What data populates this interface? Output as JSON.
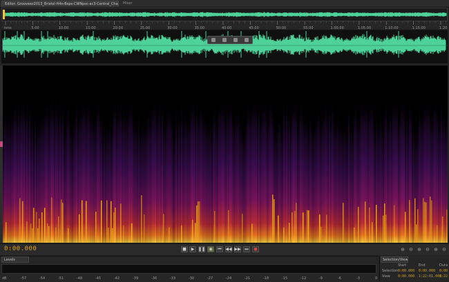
{
  "tabs": {
    "editor": "Editor: Grooveez2013_Bristol-H4n-Bsps-CWNpsc-ac3-Central_ChampDover",
    "mixer": "Mixer"
  },
  "ruler": {
    "labels": [
      "hms",
      "5:00",
      "10:00",
      "15:00",
      "20:00",
      "25:00",
      "30:00",
      "35:00",
      "40:00",
      "45:00",
      "50:00",
      "55:00",
      "1:00:00",
      "1:05:00",
      "1:10:00",
      "1:15:00",
      "1:20:00"
    ]
  },
  "transport": {
    "timecode": "0:00.000",
    "buttons": [
      "■",
      "▶",
      "❚❚",
      "◉",
      "⏮",
      "◀◀",
      "▶▶",
      "⏭",
      "●"
    ],
    "zoom_buttons": [
      "⊕",
      "⊖",
      "⊕",
      "⊖",
      "⊕",
      "⊖"
    ]
  },
  "levels": {
    "tab_label": "Levels",
    "scale": [
      "dB",
      "-57",
      "-54",
      "-51",
      "-48",
      "-45",
      "-42",
      "-39",
      "-36",
      "-33",
      "-30",
      "-27",
      "-24",
      "-21",
      "-18",
      "-15",
      "-12",
      "-9",
      "-6",
      "-3",
      "0"
    ]
  },
  "selection": {
    "tab_label": "Selection/View",
    "headers": {
      "start": "Start",
      "end": "End",
      "duration": "Dura"
    },
    "rows": [
      {
        "label": "Selection",
        "start": "0:00.000",
        "end": "0:00.000",
        "duration": "0:00"
      },
      {
        "label": "View",
        "start": "0:00.000",
        "end": "1:22:01.000",
        "duration": "1:22"
      }
    ]
  },
  "colors": {
    "waveform": "#4ed29a",
    "timecode": "#d9a21b",
    "spectral_low": "#2a0b3a",
    "spectral_high": "#f8d040"
  }
}
